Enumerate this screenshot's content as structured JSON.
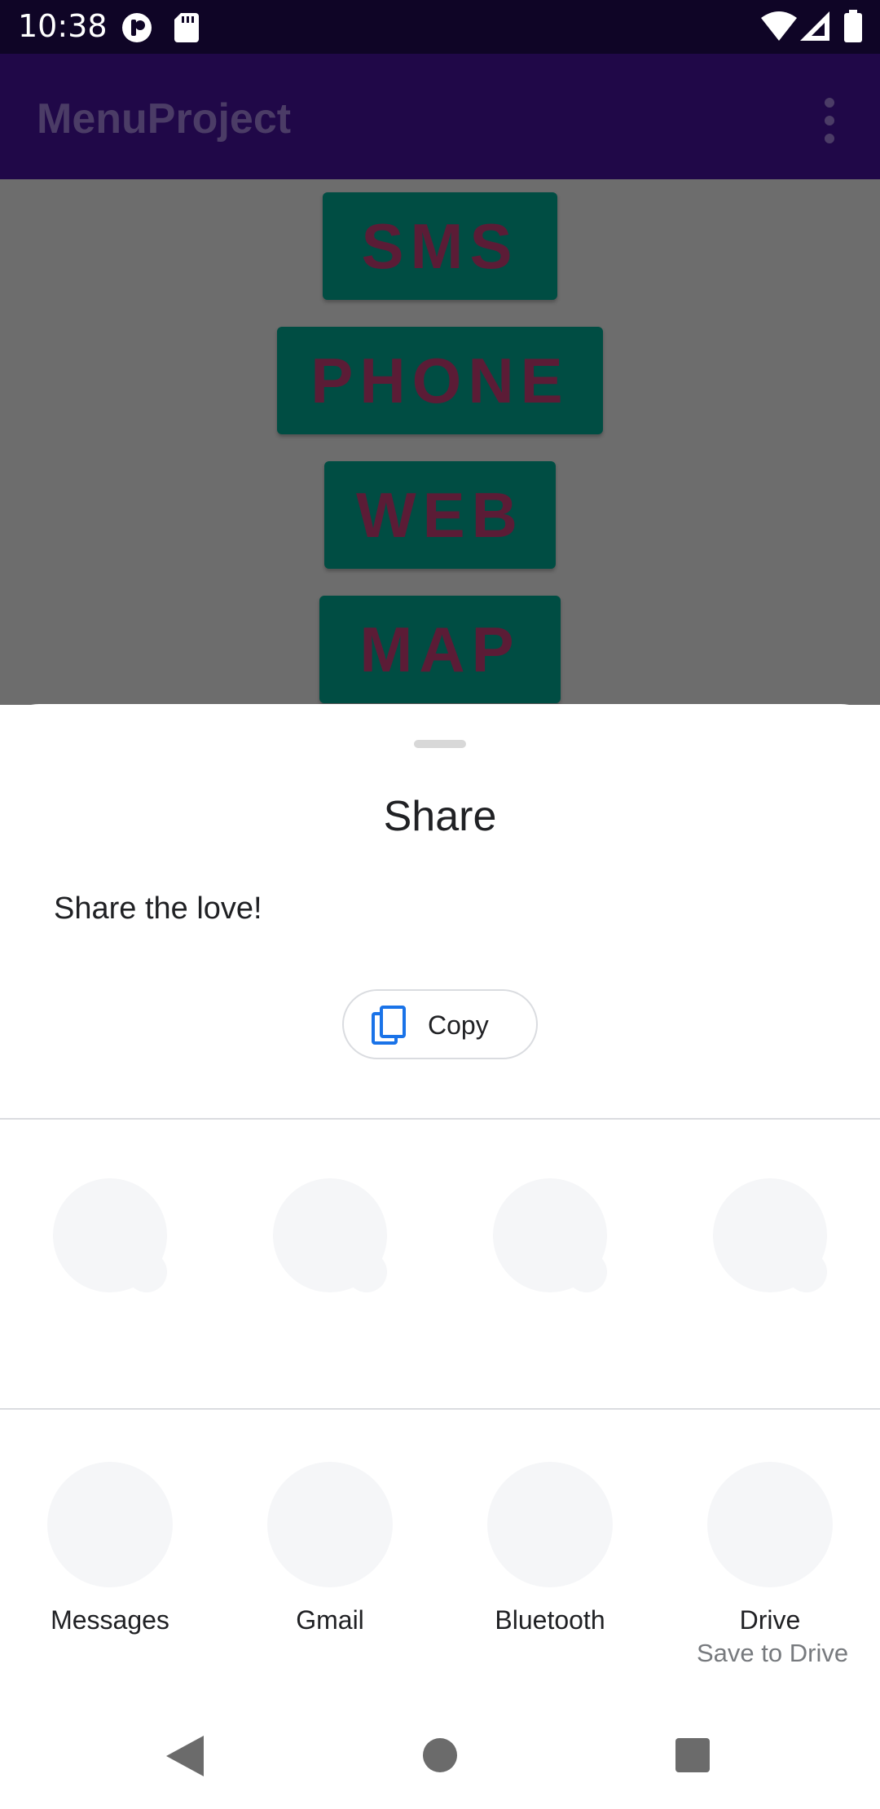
{
  "status_bar": {
    "time": "10:38",
    "icons": [
      "app-notification-icon",
      "sd-card-icon",
      "wifi-icon",
      "signal-icon",
      "battery-icon"
    ]
  },
  "app_bar": {
    "title": "MenuProject",
    "overflow_icon": "more-vert-icon"
  },
  "content": {
    "buttons": [
      "SMS",
      "PHONE",
      "WEB",
      "MAP"
    ]
  },
  "share_sheet": {
    "title": "Share",
    "text": "Share the love!",
    "copy_label": "Copy",
    "copy_icon": "copy-icon",
    "targets": [
      {
        "label": "Messages",
        "sublabel": ""
      },
      {
        "label": "Gmail",
        "sublabel": ""
      },
      {
        "label": "Bluetooth",
        "sublabel": ""
      },
      {
        "label": "Drive",
        "sublabel": "Save to Drive"
      }
    ]
  },
  "nav_bar": {
    "icons": [
      "back-icon",
      "home-icon",
      "recents-icon"
    ]
  },
  "colors": {
    "status_bar": "#0f0526",
    "app_bar": "#200848",
    "button_bg": "#004d43",
    "button_text": "#5b1c36",
    "accent": "#1a73e8"
  }
}
